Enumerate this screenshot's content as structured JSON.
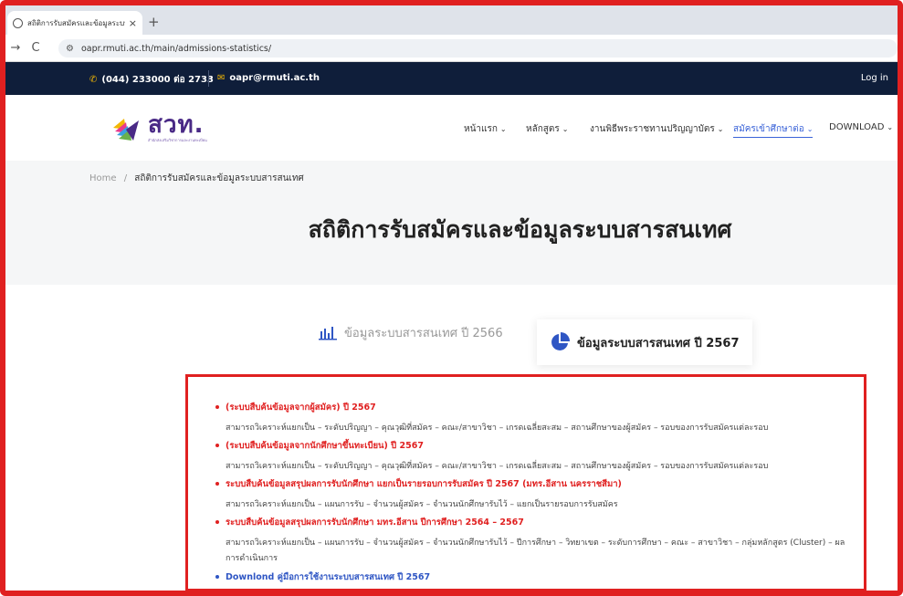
{
  "browser": {
    "tab_title": "สถิติการรับสมัครและข้อมูลระบบสารส",
    "tab_close": "×",
    "new_tab": "+",
    "back": "→",
    "reload": "C",
    "url": "oapr.rmuti.ac.th/main/admissions-statistics/"
  },
  "topbar": {
    "phone": "(044) 233000 ต่อ 2733",
    "email": "oapr@rmuti.ac.th",
    "login": "Log in"
  },
  "header": {
    "logo_text": "สวท.",
    "logo_sub": "สำนักส่งเสริมวิชาการและงานทะเบียน",
    "menu": [
      {
        "label": "หน้าแรก"
      },
      {
        "label": "หลักสูตร"
      },
      {
        "label": "งานพิธีพระราชทานปริญญาบัตร"
      },
      {
        "label": "สมัครเข้าศึกษาต่อ"
      },
      {
        "label": "DOWNLOAD"
      }
    ]
  },
  "breadcrumb": {
    "home": "Home",
    "sep": "/",
    "current": "สถิติการรับสมัครและข้อมูลระบบสารสนเทศ"
  },
  "page_title": "สถิติการรับสมัครและข้อมูลระบบสารสนเทศ",
  "tabs": [
    {
      "label": "ข้อมูลระบบสารสนเทศ ปี 2566",
      "icon": "bar-chart-icon"
    },
    {
      "label": "ข้อมูลระบบสารสนเทศ ปี 2567",
      "icon": "pie-chart-icon"
    }
  ],
  "items": [
    {
      "title": "(ระบบสืบค้นข้อมูลจากผู้สมัคร) ปี 2567",
      "desc": "สามารถวิเคราะห์แยกเป็น – ระดับปริญญา – คุณวุฒิที่สมัคร – คณะ/สาขาวิชา – เกรดเฉลี่ยสะสม – สถานศึกษาของผู้สมัคร – รอบของการรับสมัครแต่ละรอบ"
    },
    {
      "title": "(ระบบสืบค้นข้อมูลจากนักศึกษาขึ้นทะเบียน) ปี 2567",
      "desc": "สามารถวิเคราะห์แยกเป็น – ระดับปริญญา – คุณวุฒิที่สมัคร – คณะ/สาขาวิชา – เกรดเฉลี่ยสะสม – สถานศึกษาของผู้สมัคร – รอบของการรับสมัครแต่ละรอบ"
    },
    {
      "title": "ระบบสืบค้นข้อมูลสรุปผลการรับนักศึกษา แยกเป็นรายรอบการรับสมัคร ปี 2567 (มทร.อีสาน นครราชสีมา)",
      "desc": "สามารถวิเคราะห์แยกเป็น – แผนการรับ – จำนวนผู้สมัคร – จำนวนนักศึกษารับไว้ – แยกเป็นรายรอบการรับสมัคร"
    },
    {
      "title": "ระบบสืบค้นข้อมูลสรุปผลการรับนักศึกษา มทร.อีสาน ปีการศึกษา 2564 – 2567",
      "desc": "สามารถวิเคราะห์แยกเป็น – แผนการรับ – จำนวนผู้สมัคร – จำนวนนักศึกษารับไว้ – ปีการศึกษา – วิทยาเขต – ระดับการศึกษา – คณะ – สาขาวิชา – กลุ่มหลักสูตร (Cluster) – ผลการดำเนินการ"
    },
    {
      "title": "Downlond คู่มือการใช้งานระบบสารสนเทศ ปี 2567",
      "desc": ""
    }
  ],
  "colors": {
    "accent_red": "#e02020",
    "link_blue": "#2f56c4",
    "topbar_navy": "#0f1e3a",
    "logo_purple": "#4a2a86"
  }
}
